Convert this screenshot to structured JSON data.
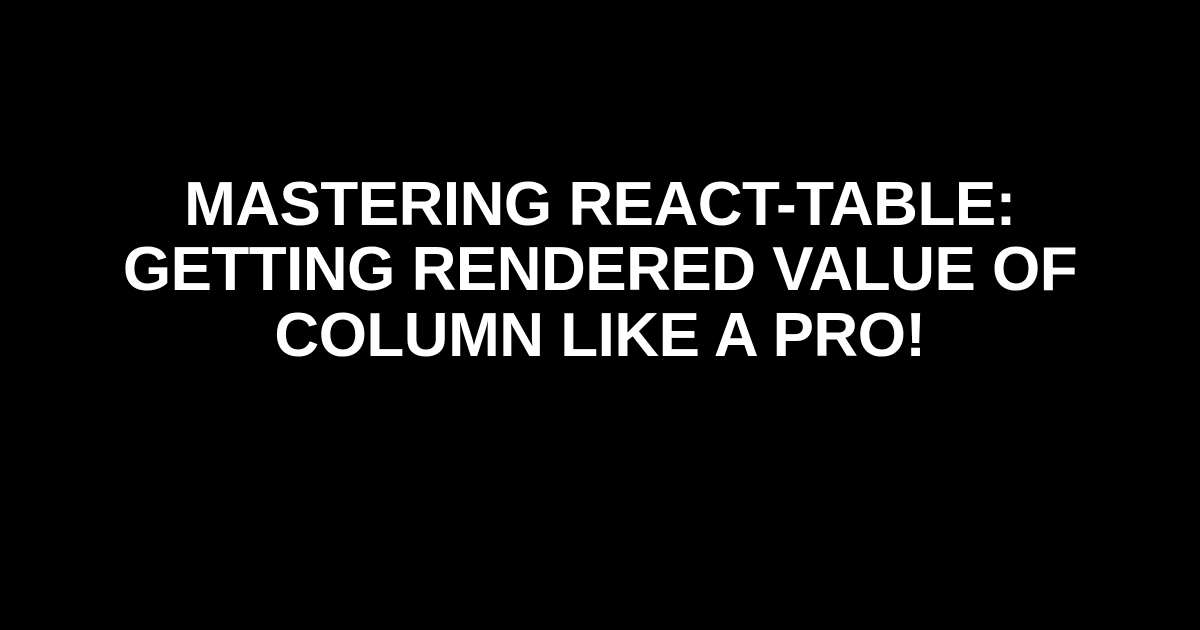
{
  "heading": {
    "text": "MASTERING REACT-TABLE: GETTING RENDERED VALUE OF COLUMN LIKE A PRO!"
  }
}
